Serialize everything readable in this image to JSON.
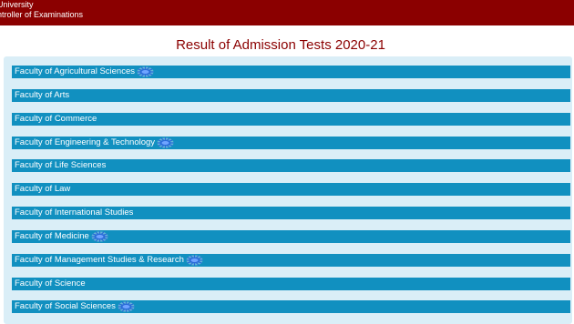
{
  "header": {
    "line1": "University",
    "line2": "ntroller of Examinations"
  },
  "page_title": "Result of Admission Tests 2020-21",
  "faculties": [
    {
      "label": "Faculty of Agricultural Sciences",
      "new_badge": true
    },
    {
      "label": "Faculty of Arts",
      "new_badge": false
    },
    {
      "label": "Faculty of Commerce",
      "new_badge": false
    },
    {
      "label": "Faculty of Engineering & Technology",
      "new_badge": true
    },
    {
      "label": "Faculty of Life Sciences",
      "new_badge": false
    },
    {
      "label": "Faculty of Law",
      "new_badge": false
    },
    {
      "label": "Faculty of International Studies",
      "new_badge": false
    },
    {
      "label": "Faculty of Medicine",
      "new_badge": true
    },
    {
      "label": "Faculty of Management Studies & Research",
      "new_badge": true
    },
    {
      "label": "Faculty of Science",
      "new_badge": false
    },
    {
      "label": "Faculty of Social Sciences",
      "new_badge": true
    }
  ],
  "colors": {
    "header_bg": "#8b0000",
    "title": "#8b0000",
    "panel_bg": "#daeef7",
    "item_bg": "#1190c0",
    "new_badge": "#2a6bd8"
  }
}
